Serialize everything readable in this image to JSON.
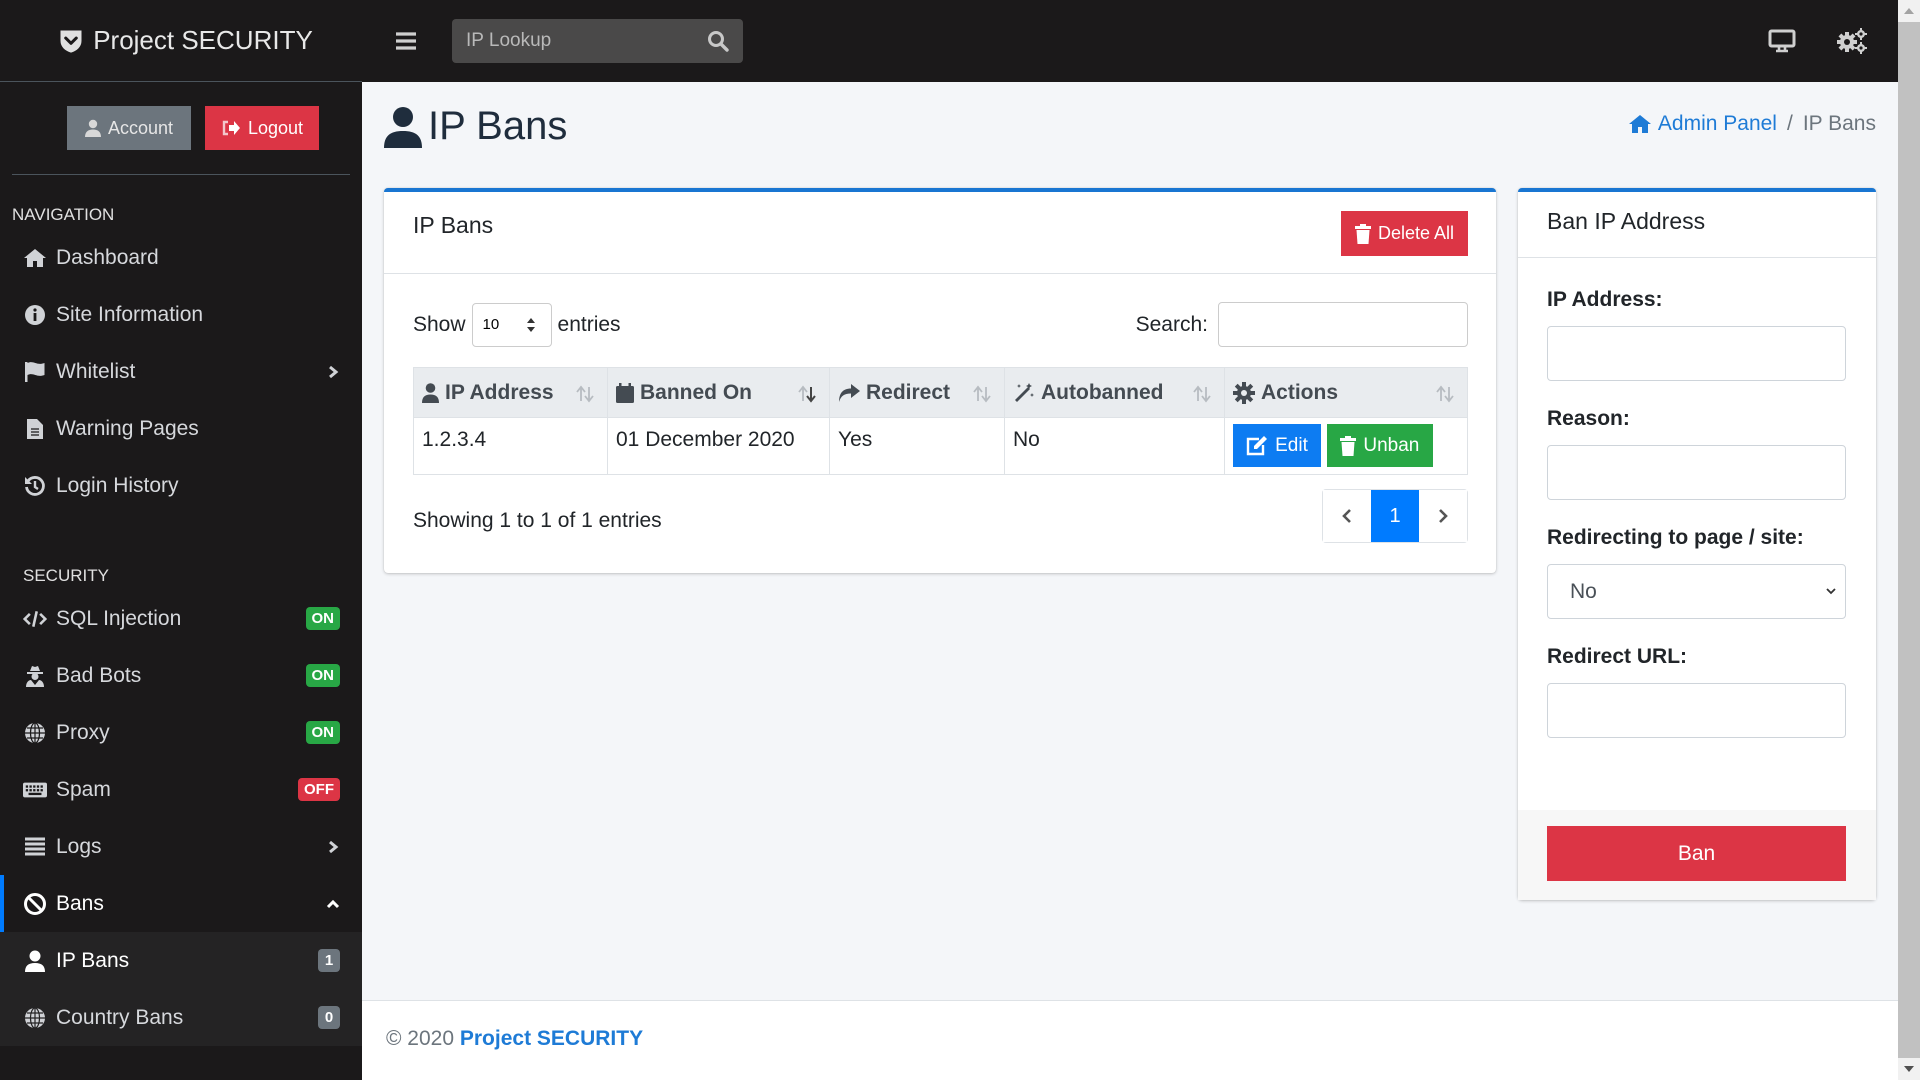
{
  "brand": {
    "name": "Project SECURITY",
    "logo_icon": "shield-check-icon"
  },
  "account": {
    "account_label": "Account",
    "logout_label": "Logout"
  },
  "topbar": {
    "search_placeholder": "IP Lookup",
    "menu_icon": "hamburger-icon",
    "search_icon": "search-icon",
    "right_icons": [
      "monitor-icon",
      "gears-icon"
    ]
  },
  "sidebar": {
    "nav_header": "NAVIGATION",
    "nav_items": [
      {
        "label": "Dashboard",
        "icon": "home-icon"
      },
      {
        "label": "Site Information",
        "icon": "info-circle-icon"
      },
      {
        "label": "Whitelist",
        "icon": "flag-icon",
        "has_submenu": true
      },
      {
        "label": "Warning Pages",
        "icon": "file-icon"
      },
      {
        "label": "Login History",
        "icon": "history-icon"
      }
    ],
    "security_header": "SECURITY",
    "security_items": [
      {
        "label": "SQL Injection",
        "icon": "code-icon",
        "status": "ON"
      },
      {
        "label": "Bad Bots",
        "icon": "user-secret-icon",
        "status": "ON"
      },
      {
        "label": "Proxy",
        "icon": "globe-icon",
        "status": "ON"
      },
      {
        "label": "Spam",
        "icon": "keyboard-icon",
        "status": "OFF"
      },
      {
        "label": "Logs",
        "icon": "list-icon",
        "has_submenu": true
      },
      {
        "label": "Bans",
        "icon": "ban-icon",
        "expanded": true
      }
    ],
    "bans_submenu": [
      {
        "label": "IP Bans",
        "icon": "user-icon",
        "count": "1",
        "current": true
      },
      {
        "label": "Country Bans",
        "icon": "globe-icon",
        "count": "0"
      }
    ]
  },
  "page": {
    "title": "IP Bans",
    "breadcrumb": [
      {
        "label": "Admin Panel",
        "link": true
      },
      {
        "label": "IP Bans"
      }
    ]
  },
  "bans_card": {
    "title": "IP Bans",
    "delete_all_label": "Delete All",
    "show_label": "Show",
    "entries_label": "entries",
    "page_length": "10",
    "search_label": "Search:",
    "search_value": "",
    "columns": [
      {
        "label": "IP Address",
        "icon": "user-icon"
      },
      {
        "label": "Banned On",
        "icon": "calendar-icon"
      },
      {
        "label": "Redirect",
        "icon": "share-icon"
      },
      {
        "label": "Autobanned",
        "icon": "magic-icon"
      },
      {
        "label": "Actions",
        "icon": "cog-icon"
      }
    ],
    "rows": [
      {
        "ip": "1.2.3.4",
        "banned_on": "01 December 2020",
        "redirect": "Yes",
        "autobanned": "No",
        "edit_label": "Edit",
        "unban_label": "Unban"
      }
    ],
    "info": "Showing 1 to 1 of 1 entries",
    "pagination": {
      "prev": "‹",
      "current": "1",
      "next": "›"
    }
  },
  "ban_form": {
    "title": "Ban IP Address",
    "ip_label": "IP Address:",
    "ip_value": "",
    "reason_label": "Reason:",
    "reason_value": "",
    "redirect_label": "Redirecting to page / site:",
    "redirect_selected": "No",
    "url_label": "Redirect URL:",
    "url_value": "",
    "submit_label": "Ban"
  },
  "footer": {
    "copyright": "© 2020",
    "link_label": "Project SECURITY"
  },
  "colors": {
    "accent": "#007bff",
    "danger": "#dc3545",
    "success": "#28a745",
    "sidebar_bg": "#1b191a"
  }
}
